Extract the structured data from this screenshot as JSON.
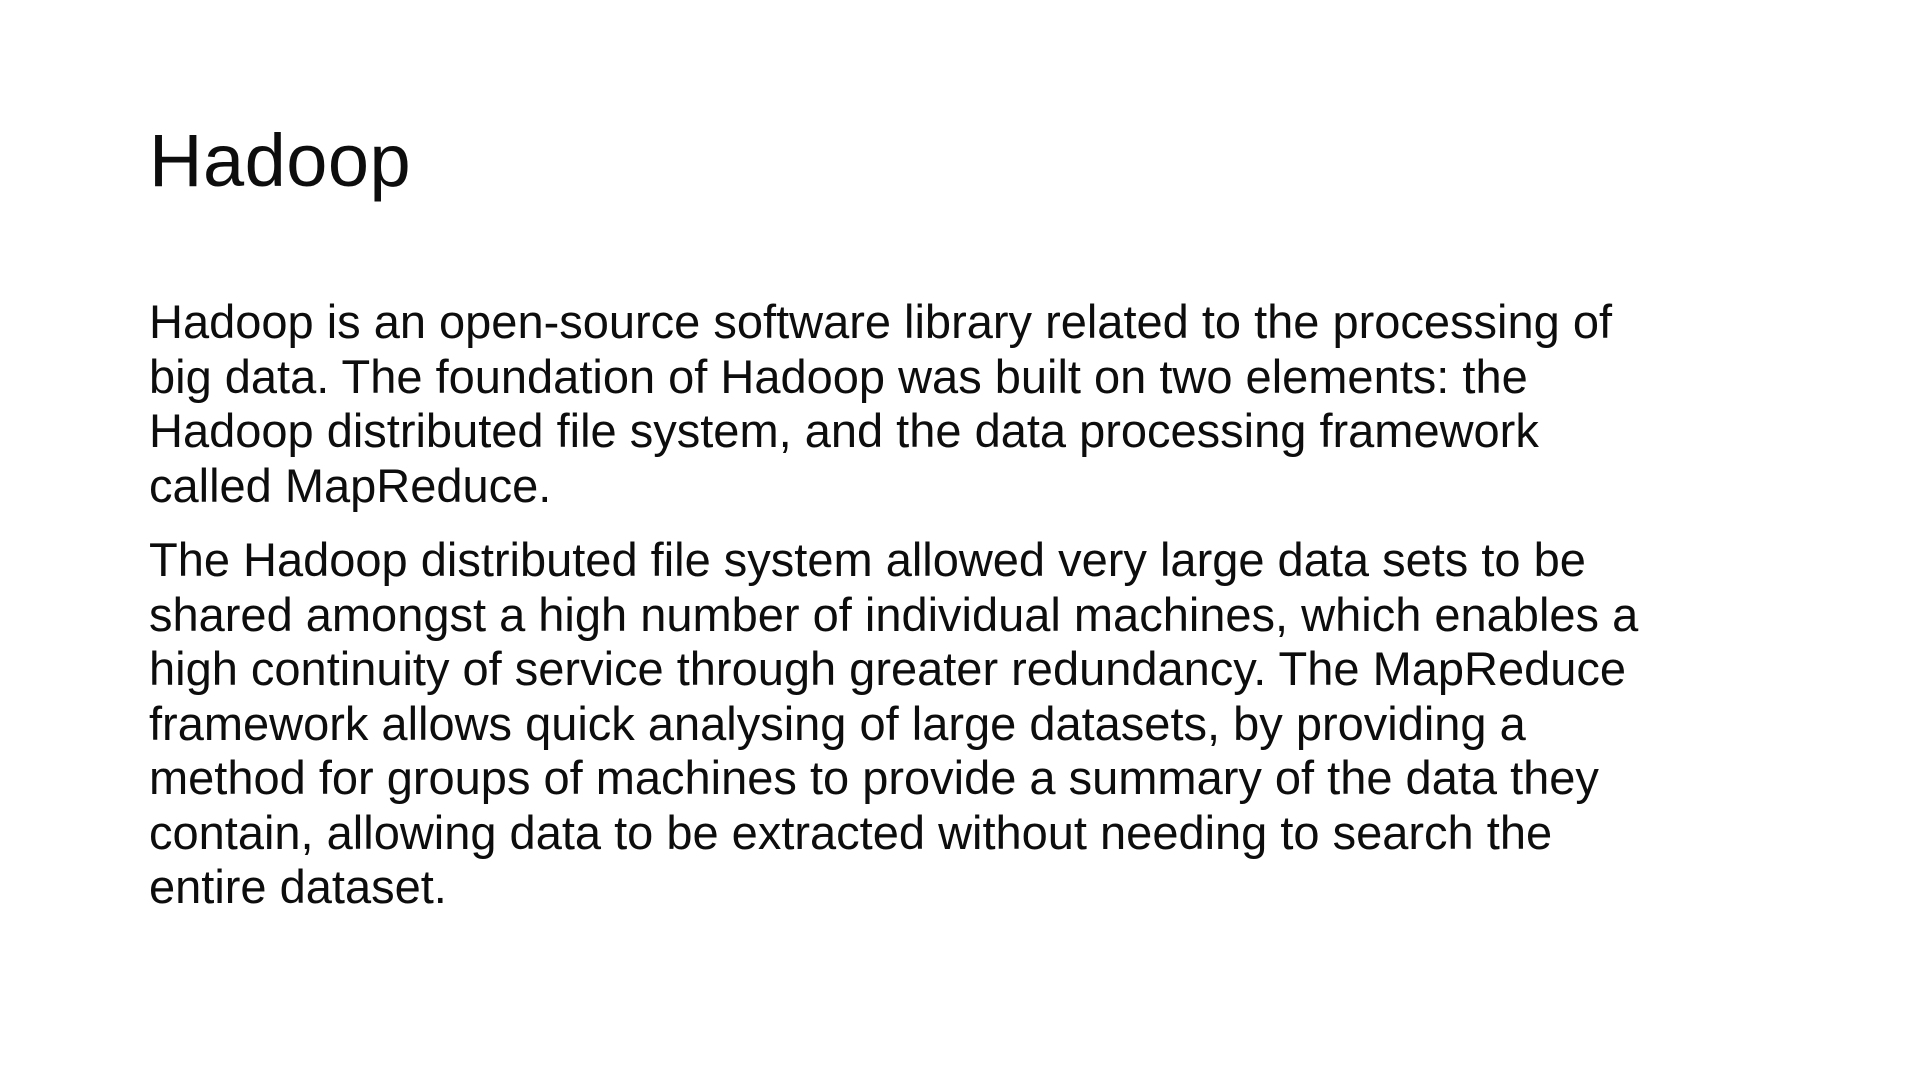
{
  "slide": {
    "title": "Hadoop",
    "paragraphs": [
      {
        "lines": [
          "Hadoop is an open-source software library related to the processing of",
          "big data. The foundation of Hadoop was built on two elements: the",
          "Hadoop distributed file system, and the data processing framework",
          "called MapReduce."
        ]
      },
      {
        "lines": [
          "The Hadoop distributed file system allowed very large data sets to be",
          "shared amongst a high number of individual machines, which enables a",
          "high continuity of service through greater redundancy. The MapReduce",
          "framework allows quick analysing of large datasets, by providing a",
          "method for groups of machines to provide a summary of the data they",
          "contain, allowing data to be extracted without needing to search the",
          "entire dataset."
        ]
      }
    ]
  }
}
